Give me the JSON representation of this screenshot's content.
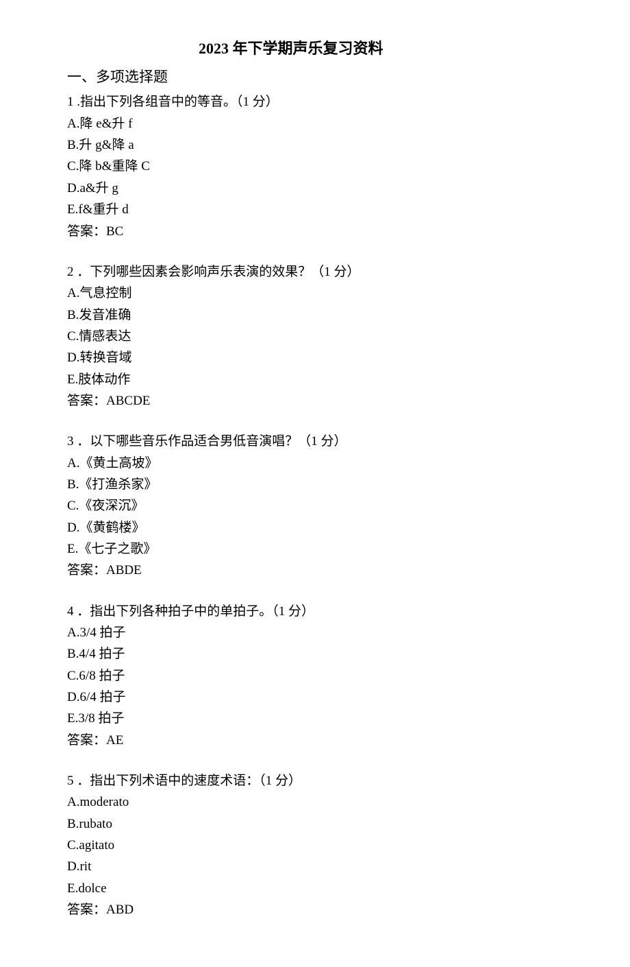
{
  "title": "2023 年下学期声乐复习资料",
  "section": "一、多项选择题",
  "questions": [
    {
      "num": "1",
      "text": " .指出下列各组音中的等音。（1 分）",
      "options": [
        "A.降 e&升 f",
        "B.升 g&降 a",
        "C.降 b&重降 C",
        "D.a&升 g",
        "E.f&重升 d"
      ],
      "answer": "答案：BC"
    },
    {
      "num": "2",
      "text": " ．下列哪些因素会影响声乐表演的效果？（1 分）",
      "options": [
        "A.气息控制",
        "B.发音准确",
        "C.情感表达",
        "D.转换音域",
        "E.肢体动作"
      ],
      "answer": "答案：ABCDE"
    },
    {
      "num": "3",
      "text": " ．以下哪些音乐作品适合男低音演唱？（1 分）",
      "options": [
        "A.《黄土高坡》",
        "B.《打渔杀家》",
        "C.《夜深沉》",
        "D.《黄鹤楼》",
        "E.《七子之歌》"
      ],
      "answer": "答案：ABDE"
    },
    {
      "num": "4",
      "text": " ．指出下列各种拍子中的单拍子。（1 分）",
      "options": [
        "A.3/4 拍子",
        "B.4/4 拍子",
        "C.6/8 拍子",
        "D.6/4 拍子",
        "E.3/8 拍子"
      ],
      "answer": "答案：AE"
    },
    {
      "num": "5",
      "text": " ．指出下列术语中的速度术语：（1 分）",
      "options": [
        "A.moderato",
        "B.rubato",
        "C.agitato",
        "D.rit",
        "E.dolce"
      ],
      "answer": "答案：ABD"
    }
  ]
}
